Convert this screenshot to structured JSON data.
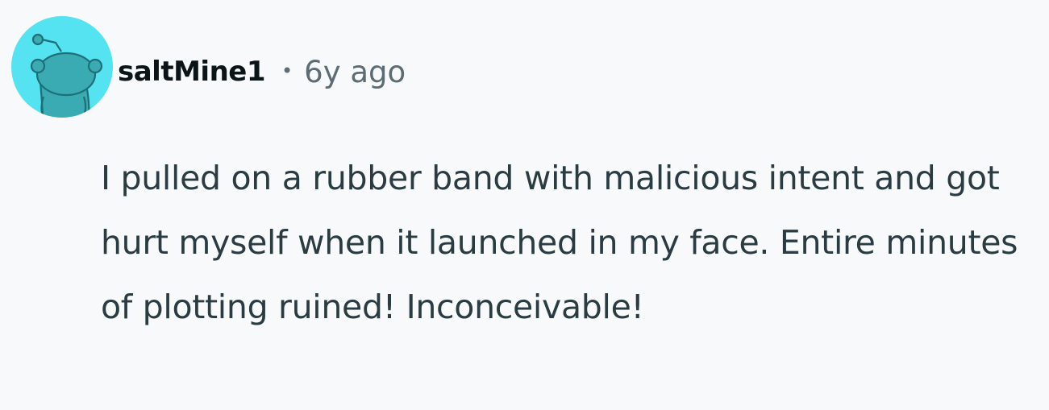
{
  "comment": {
    "author": "saltMine1",
    "separator": "•",
    "timestamp": "6y ago",
    "body": "I pulled on a rubber band with malicious intent and got hurt myself when it launched in my face. Entire minutes of plotting ruined! Inconceivable!"
  },
  "avatar": {
    "icon": "snoo-avatar-icon",
    "background_color": "#55e2f1",
    "figure_color": "#3aaab3"
  },
  "colors": {
    "page_background": "#f7f9fa",
    "username": "#0b1416",
    "meta_text": "#5c6c74",
    "body_text": "#2a3c42"
  }
}
